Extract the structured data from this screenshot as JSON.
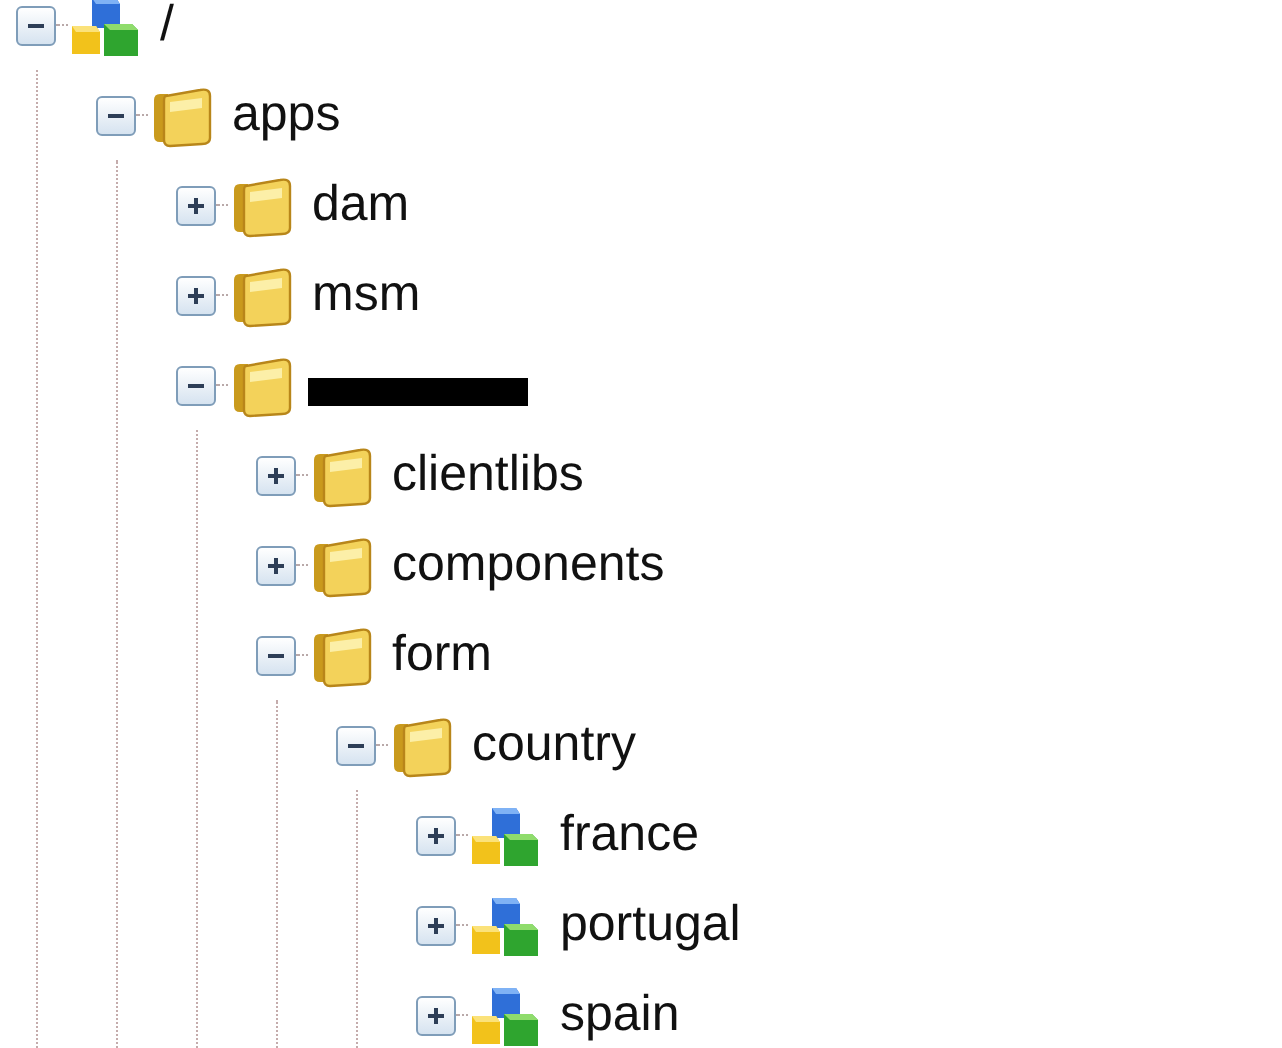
{
  "tree": [
    {
      "label": "/",
      "kind": "component",
      "expanded": true,
      "redacted": false,
      "children": [
        {
          "label": "apps",
          "kind": "folder",
          "expanded": true,
          "redacted": false,
          "children": [
            {
              "label": "dam",
              "kind": "folder",
              "expanded": false,
              "redacted": false
            },
            {
              "label": "msm",
              "kind": "folder",
              "expanded": false,
              "redacted": false
            },
            {
              "kind": "folder",
              "expanded": true,
              "redacted": true,
              "children": [
                {
                  "label": "clientlibs",
                  "kind": "folder",
                  "expanded": false,
                  "redacted": false
                },
                {
                  "label": "components",
                  "kind": "folder",
                  "expanded": false,
                  "redacted": false
                },
                {
                  "label": "form",
                  "kind": "folder",
                  "expanded": true,
                  "redacted": false,
                  "children": [
                    {
                      "label": "country",
                      "kind": "folder",
                      "expanded": true,
                      "redacted": false,
                      "children": [
                        {
                          "label": "france",
                          "kind": "component",
                          "expanded": false,
                          "redacted": false
                        },
                        {
                          "label": "portugal",
                          "kind": "component",
                          "expanded": false,
                          "redacted": false
                        },
                        {
                          "label": "spain",
                          "kind": "component",
                          "expanded": false,
                          "redacted": false
                        }
                      ]
                    }
                  ]
                }
              ]
            }
          ]
        }
      ]
    }
  ]
}
